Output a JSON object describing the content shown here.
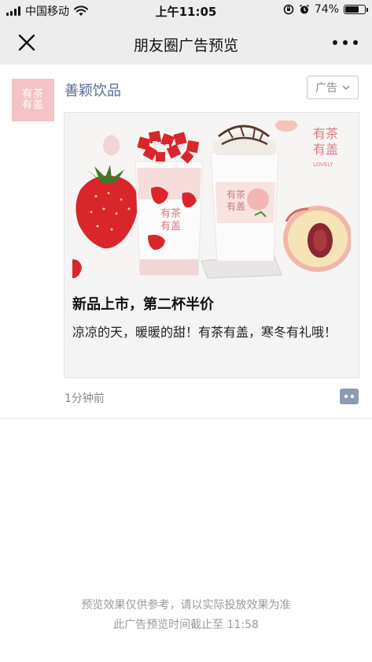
{
  "status_bar": {
    "carrier": "中国移动",
    "time": "上午11:05",
    "battery": "74%",
    "battery_level": 0.74
  },
  "nav": {
    "title": "朋友圈广告预览"
  },
  "post": {
    "advertiser": "善颖饮品",
    "avatar_logo": [
      "有茶",
      "有盖"
    ],
    "ad_tag": "广告",
    "headline": "新品上市，第二杯半价",
    "description": "凉凉的天，暖暖的甜！有茶有盖，寒冬有礼哦！",
    "image_logo": [
      "有茶",
      "有盖"
    ],
    "cup_logo": [
      "有茶",
      "有盖"
    ],
    "lovely": "LOVELY",
    "time_ago": "1分钟前"
  },
  "footer": {
    "line1": "预览效果仅供参考，请以实际投放效果为准",
    "line2": "此广告预览时间截止至 11:58"
  },
  "colors": {
    "nav_bg": "#ededed",
    "link_blue": "#576b95",
    "avatar_pink": "#f3c3c6",
    "muted": "#888888"
  }
}
